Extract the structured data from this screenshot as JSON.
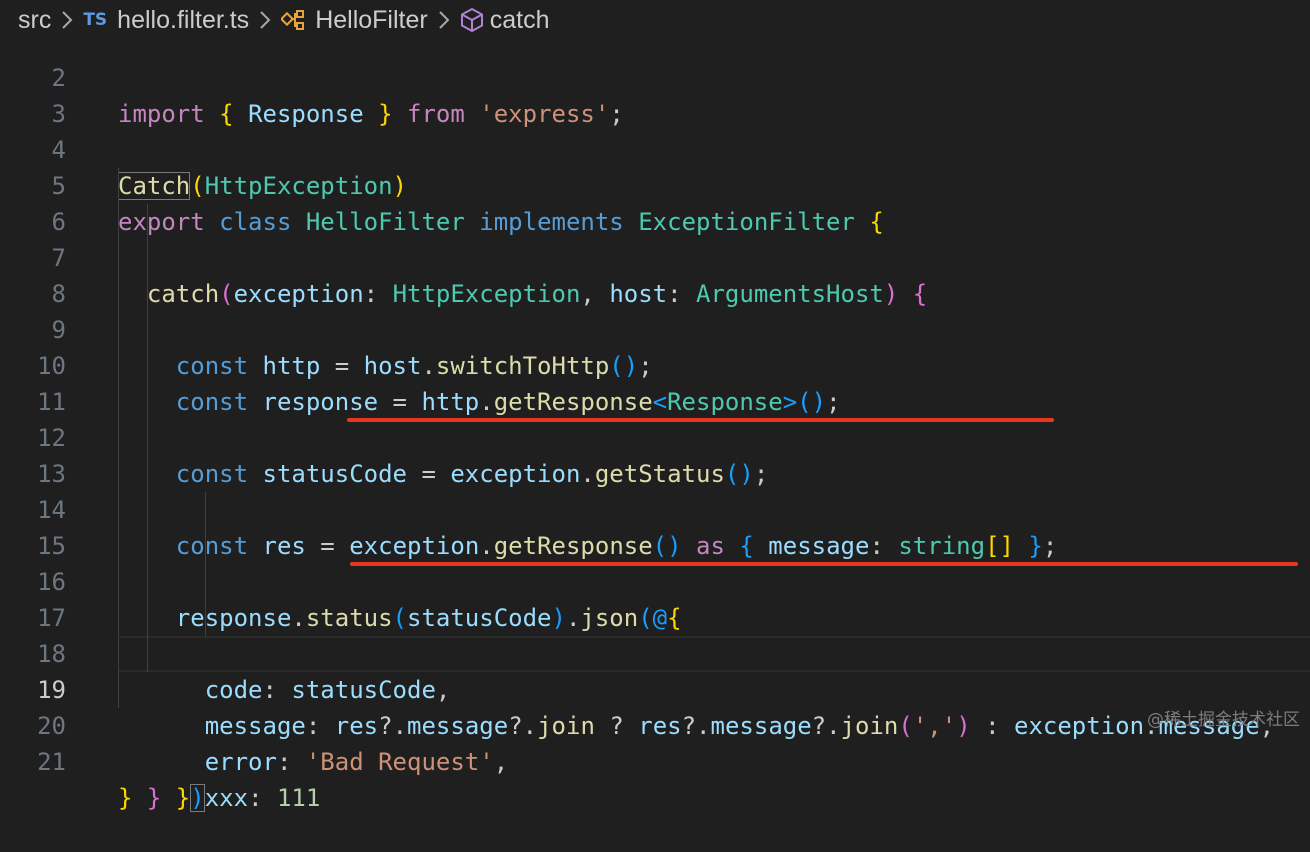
{
  "breadcrumb": {
    "folder": "src",
    "file_badge": "TS",
    "file": "hello.filter.ts",
    "class_name": "HelloFilter",
    "method_name": "catch"
  },
  "editor": {
    "lines": [
      {
        "number": "2",
        "text": "import { Response } from 'express';"
      },
      {
        "number": "3",
        "text": ""
      },
      {
        "number": "4",
        "text": "@Catch(HttpException)"
      },
      {
        "number": "5",
        "text": "export class HelloFilter implements ExceptionFilter {"
      },
      {
        "number": "6",
        "text": "  catch(exception: HttpException, host: ArgumentsHost) {"
      },
      {
        "number": "7",
        "text": "    const http = host.switchToHttp();"
      },
      {
        "number": "8",
        "text": "    const response = http.getResponse<Response>();"
      },
      {
        "number": "9",
        "text": ""
      },
      {
        "number": "10",
        "text": "    const statusCode = exception.getStatus();"
      },
      {
        "number": "11",
        "text": ""
      },
      {
        "number": "12",
        "text": "    const res = exception.getResponse() as { message: string[] };"
      },
      {
        "number": "13",
        "text": ""
      },
      {
        "number": "14",
        "text": "    response.status(statusCode).json({"
      },
      {
        "number": "15",
        "text": "      code: statusCode,"
      },
      {
        "number": "16",
        "text": "      message: res?.message?.join ? res?.message?.join(',') : exception.message,"
      },
      {
        "number": "17",
        "text": "      error: 'Bad Request',"
      },
      {
        "number": "18",
        "text": "      xxx: 111"
      },
      {
        "number": "19",
        "text": "    })"
      },
      {
        "number": "20",
        "text": "  }"
      },
      {
        "number": "21",
        "text": "}"
      }
    ],
    "current_line": "19"
  },
  "colors": {
    "background": "#1f1f1f",
    "underline_annotation": "#e8361f",
    "ts_badge": "#5d9ae0"
  },
  "watermark": "@稀土掘金技术社区"
}
